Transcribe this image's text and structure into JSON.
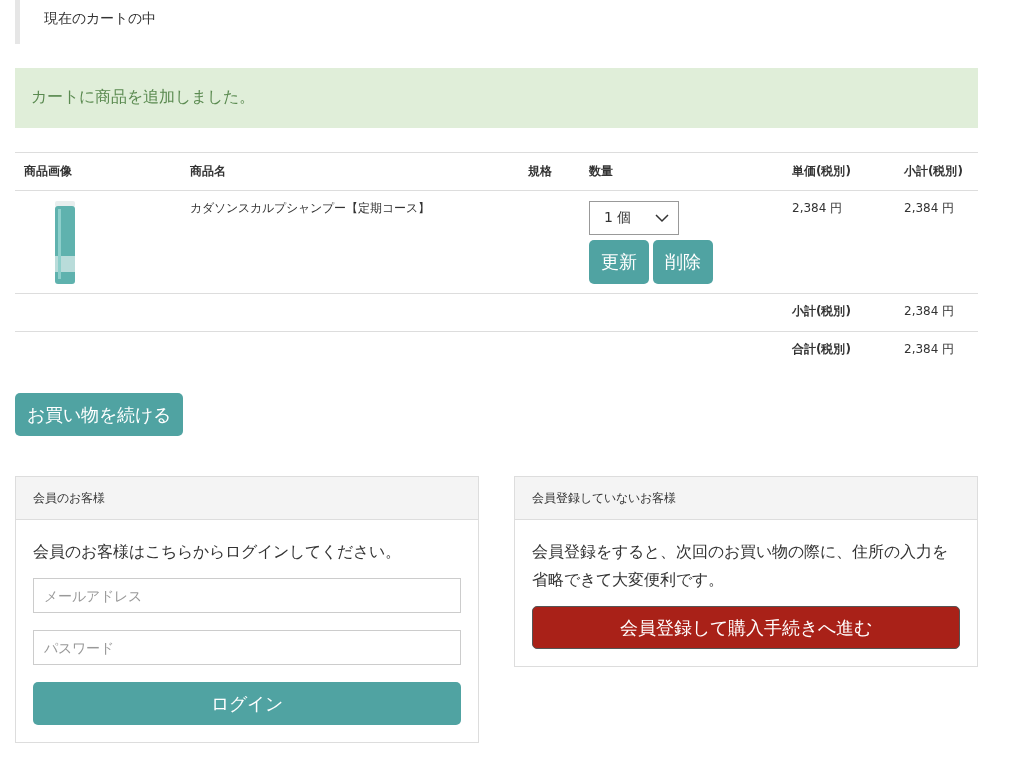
{
  "heading": "現在のカートの中",
  "alert": "カートに商品を追加しました。",
  "cart": {
    "columns": [
      "商品画像",
      "商品名",
      "規格",
      "数量",
      "単価(税別)",
      "小計(税別)"
    ],
    "items": [
      {
        "name": "カダソンスカルプシャンプー【定期コース】",
        "quantity": "1 個",
        "unit_price": "2,384 円",
        "subtotal": "2,384 円",
        "buttons": [
          "更新",
          "削除"
        ]
      }
    ],
    "summary": [
      {
        "label": "小計(税別)",
        "value": "2,384 円"
      },
      {
        "label": "合計(税別)",
        "value": "2,384 円"
      }
    ]
  },
  "continue_button": "お買い物を続ける",
  "member_panel": {
    "title": "会員のお客様",
    "text": "会員のお客様はこちらからログインしてください。",
    "email": {
      "placeholder": "メールアドレス"
    },
    "password": {
      "placeholder": "パスワード"
    },
    "button": "ログイン"
  },
  "guest_panel": {
    "title": "会員登録していないお客様",
    "text": "会員登録をすると、次回のお買い物の際に、住所の入力を省略できて大変便利です。",
    "button": "会員登録して購入手続きへ進む"
  }
}
